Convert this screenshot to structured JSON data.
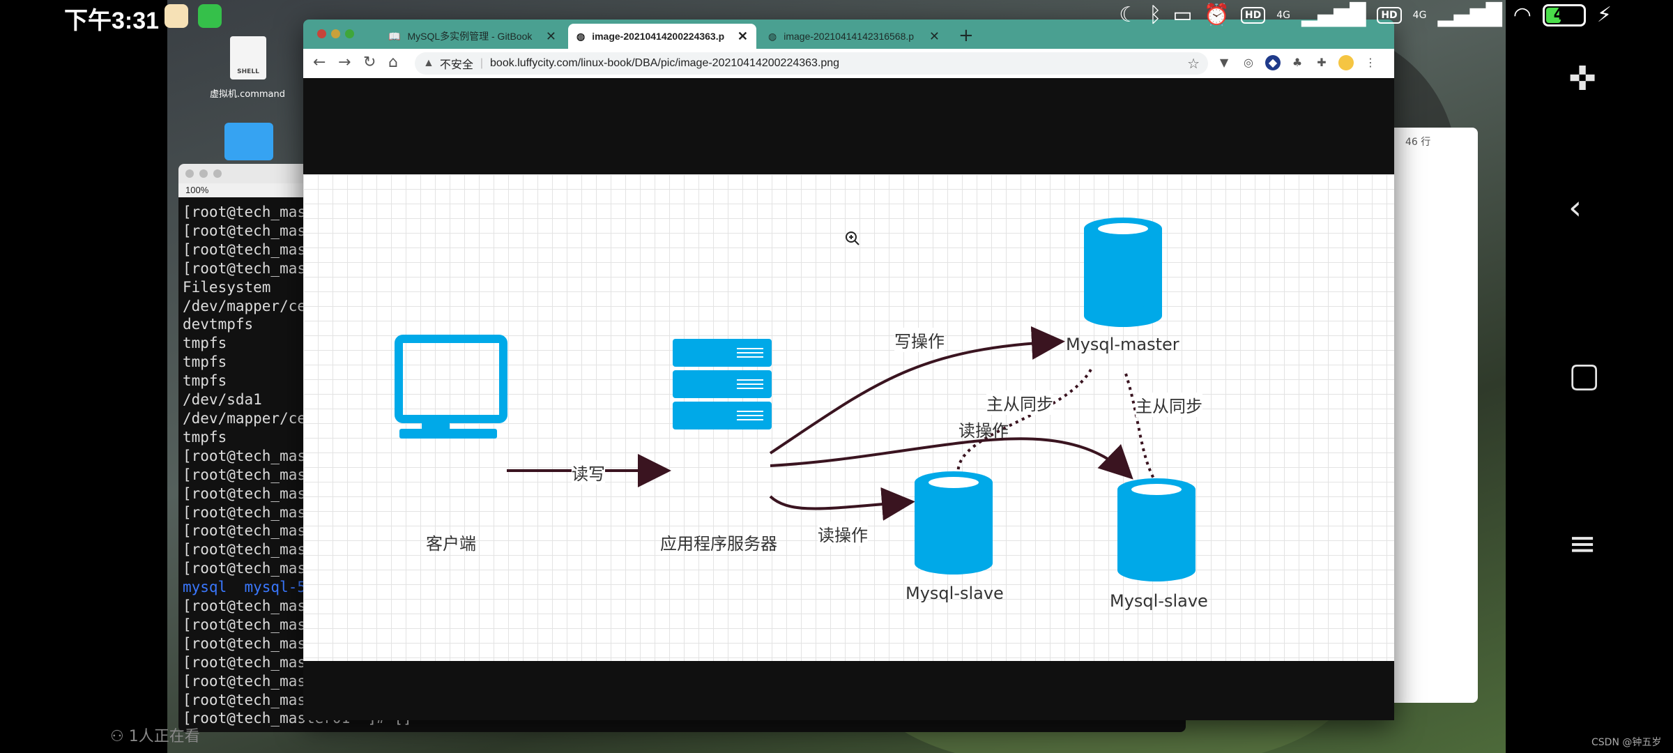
{
  "status_bar": {
    "time": "下午3:31",
    "network_1": "4G",
    "network_2": "4G",
    "hd_1": "HD",
    "hd_2": "HD",
    "battery": "40",
    "battery_level": 0.4
  },
  "desktop": {
    "file_icon_text": "SHELL",
    "file_label": "虚拟机.command"
  },
  "side_panel": {
    "text": "46 行"
  },
  "terminal": {
    "zoom": "100%",
    "lines": [
      "[root@tech_mas",
      "[root@tech_mas",
      "[root@tech_mas",
      "[root@tech_mas",
      "Filesystem",
      "/dev/mapper/ce",
      "devtmpfs",
      "tmpfs",
      "tmpfs",
      "tmpfs",
      "/dev/sda1",
      "/dev/mapper/ce",
      "tmpfs",
      "[root@tech_mas",
      "[root@tech_mas",
      "[root@tech_mas",
      "[root@tech_mas",
      "[root@tech_mas",
      "[root@tech_mas",
      "[root@tech_mas"
    ],
    "mysql_line": {
      "a": "mysql",
      "b": "mysql-5"
    },
    "lines_after": [
      "[root@tech_mas",
      "[root@tech_mas",
      "[root@tech_mas",
      "[root@tech_mas",
      "[root@tech_mas",
      "[root@tech_mas",
      "[root@tech_master01 ~]# []"
    ]
  },
  "browser": {
    "tabs": [
      {
        "label": "MySQL多实例管理 - GitBook",
        "active": false
      },
      {
        "label": "image-20210414200224363.p",
        "active": true
      },
      {
        "label": "image-20210414142316568.p",
        "active": false
      }
    ],
    "security_label": "不安全",
    "url": "book.luffycity.com/linux-book/DBA/pic/image-20210414200224363.png"
  },
  "diagram": {
    "nodes": {
      "client": "客户端",
      "app_server": "应用程序服务器",
      "master": "Mysql-master",
      "slave1": "Mysql-slave",
      "slave2": "Mysql-slave"
    },
    "edges": {
      "read_write": "读写",
      "write_op": "写操作",
      "read_op_1": "读操作",
      "read_op_2": "读操作",
      "sync_1": "主从同步",
      "sync_2": "主从同步"
    },
    "colors": {
      "node": "#00a9e8",
      "arrow": "#3a1420"
    }
  },
  "watching": "1人正在看",
  "watermark": "CSDN @钟五岁"
}
